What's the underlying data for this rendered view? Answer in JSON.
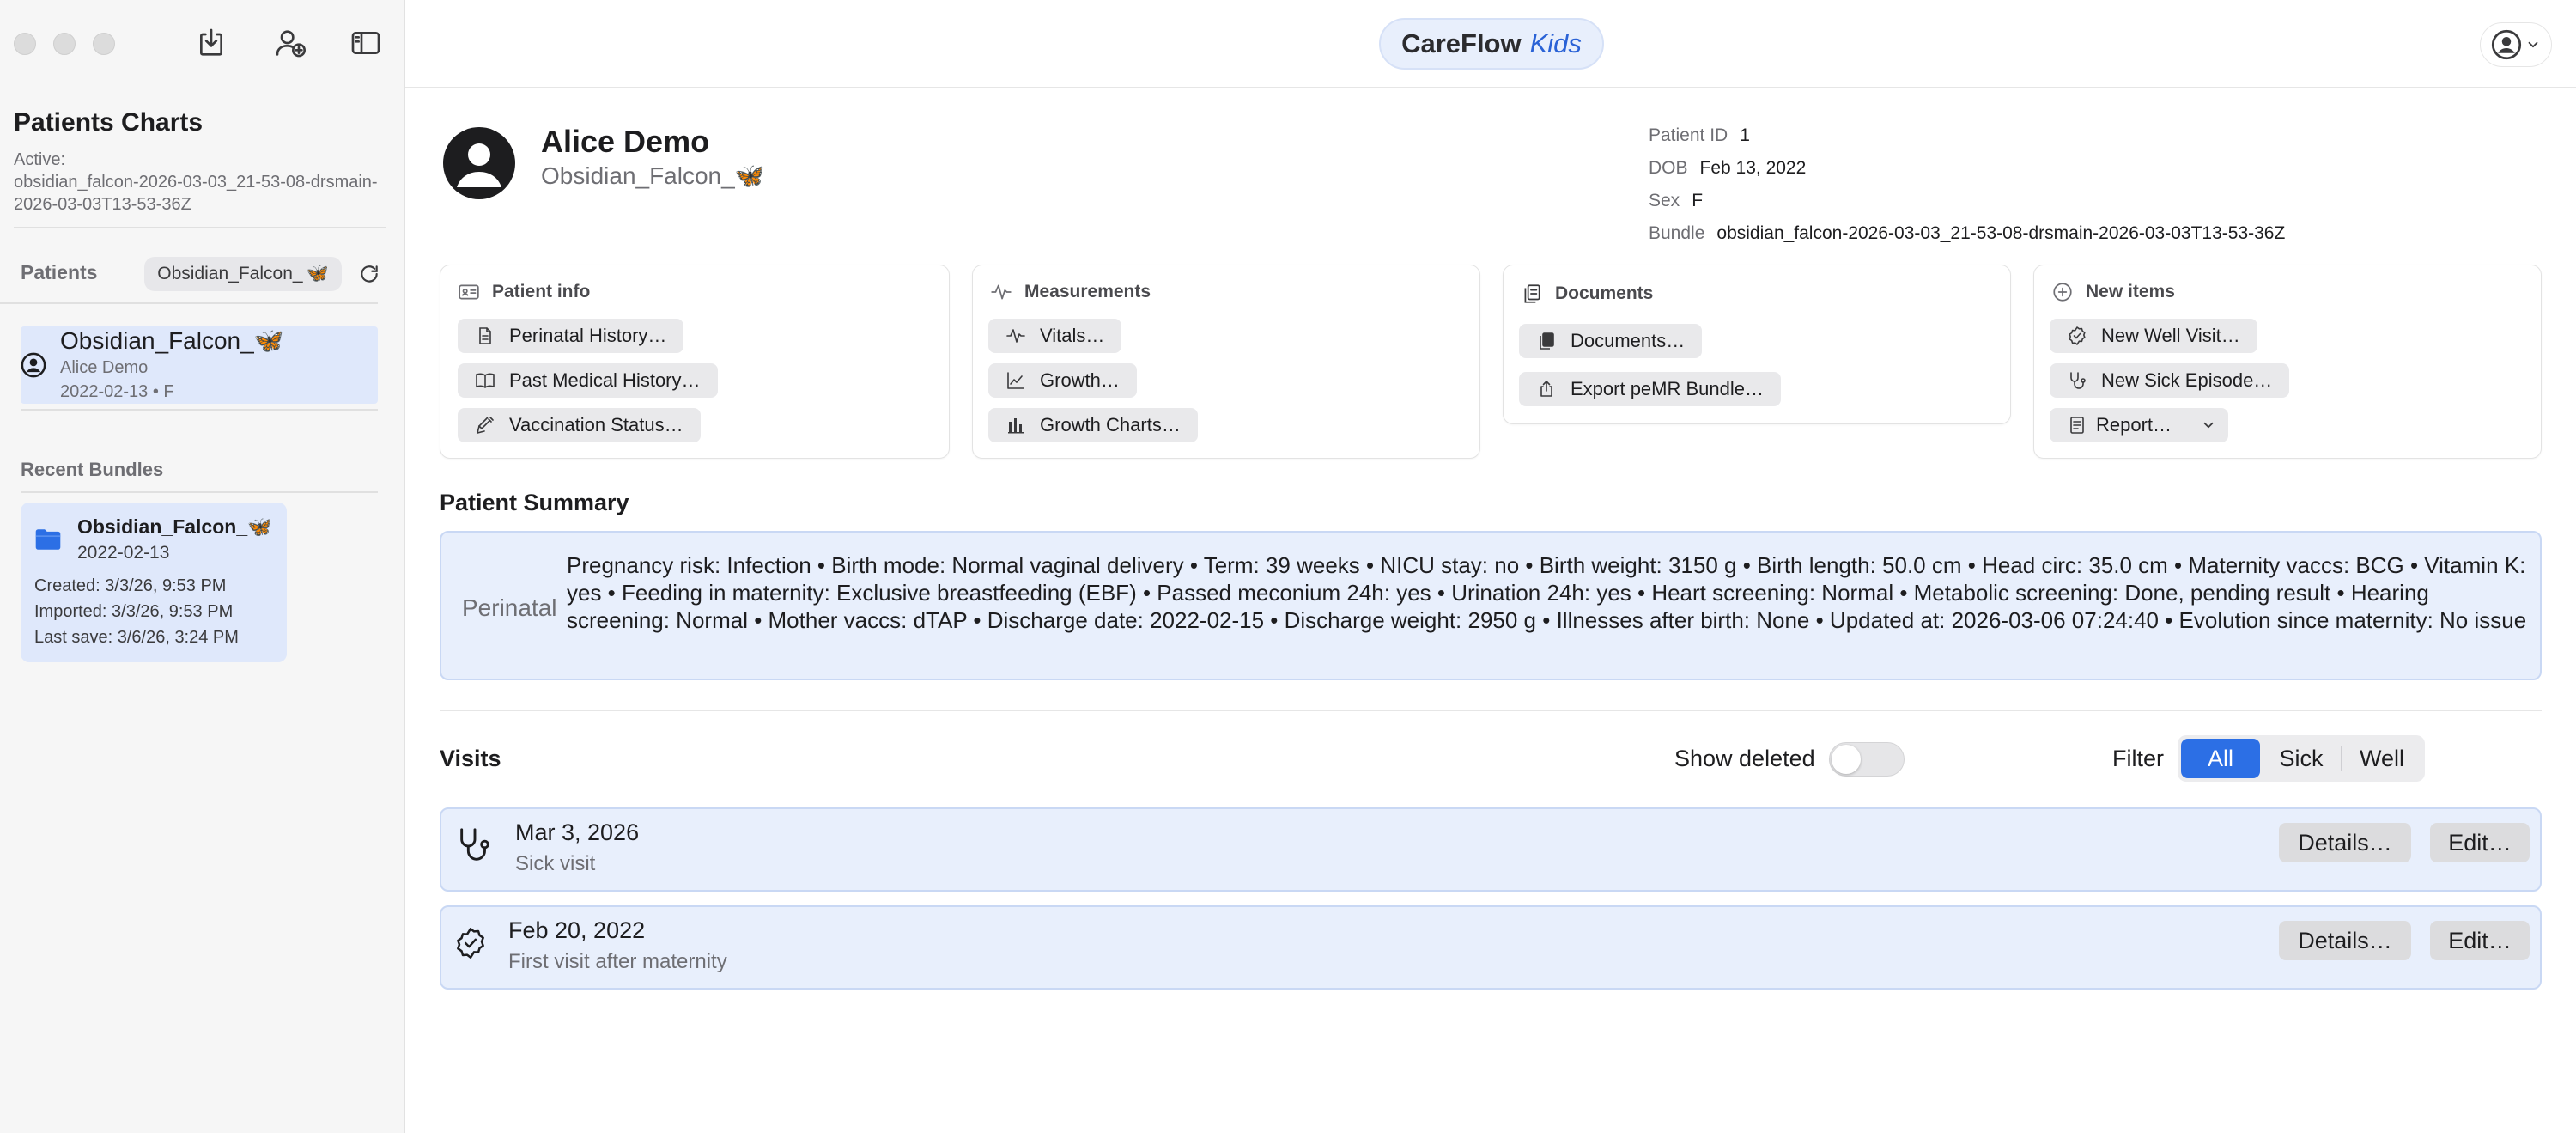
{
  "sidebar": {
    "title": "Patients Charts",
    "active_label": "Active:",
    "active_value": "obsidian_falcon-2026-03-03_21-53-08-drsmain-2026-03-03T13-53-36Z",
    "patients_label": "Patients",
    "patient_chip": "Obsidian_Falcon_",
    "patient": {
      "name": "Obsidian_Falcon_",
      "sub": "Alice Demo",
      "dob_sex": "2022-02-13 • F"
    },
    "recent_label": "Recent Bundles",
    "bundle": {
      "name": "Obsidian_Falcon_",
      "date": "2022-02-13",
      "created": "Created: 3/3/26, 9:53 PM",
      "imported": "Imported: 3/3/26, 9:53 PM",
      "last_save": "Last save: 3/6/26, 3:24 PM"
    }
  },
  "topbar": {
    "brand_main": "CareFlow",
    "brand_accent": "Kids"
  },
  "header": {
    "name": "Alice Demo",
    "alias": "Obsidian_Falcon_",
    "meta": [
      {
        "key": "Patient ID",
        "value": "1"
      },
      {
        "key": "DOB",
        "value": "Feb 13, 2022"
      },
      {
        "key": "Sex",
        "value": "F"
      },
      {
        "key": "Bundle",
        "value": "obsidian_falcon-2026-03-03_21-53-08-drsmain-2026-03-03T13-53-36Z"
      }
    ]
  },
  "cards": {
    "patient_info": {
      "title": "Patient info",
      "buttons": [
        "Perinatal History…",
        "Past Medical History…",
        "Vaccination Status…"
      ]
    },
    "measurements": {
      "title": "Measurements",
      "buttons": [
        "Vitals…",
        "Growth…",
        "Growth Charts…"
      ]
    },
    "documents": {
      "title": "Documents",
      "buttons": [
        "Documents…",
        "Export peMR Bundle…"
      ]
    },
    "new_items": {
      "title": "New items",
      "buttons": [
        "New Well Visit…",
        "New Sick Episode…",
        "Report…"
      ]
    }
  },
  "summary": {
    "title": "Patient Summary",
    "label": "Perinatal",
    "text": "Pregnancy risk: Infection • Birth mode: Normal vaginal delivery • Term: 39 weeks • NICU stay: no • Birth weight: 3150 g • Birth length: 50.0 cm • Head circ: 35.0 cm • Maternity vaccs: BCG • Vitamin K: yes • Feeding in maternity: Exclusive breastfeeding (EBF) • Passed meconium 24h: yes • Urination 24h: yes • Heart screening: Normal • Metabolic screening: Done, pending result • Hearing screening: Normal • Mother vaccs: dTAP • Discharge date: 2022-02-15 • Discharge weight: 2950 g • Illnesses after birth: None • Updated at: 2026-03-06 07:24:40 • Evolution since maternity: No issue"
  },
  "visits": {
    "title": "Visits",
    "show_deleted": "Show deleted",
    "show_deleted_on": false,
    "filter_label": "Filter",
    "filter_options": [
      "All",
      "Sick",
      "Well"
    ],
    "filter_selected": "All",
    "details_label": "Details…",
    "edit_label": "Edit…",
    "items": [
      {
        "date": "Mar 3, 2026",
        "type": "Sick visit",
        "icon": "stethoscope-icon"
      },
      {
        "date": "Feb 20, 2022",
        "type": "First visit after maternity",
        "icon": "checkmark-seal-icon"
      }
    ]
  },
  "colors": {
    "accent": "#2c6fe5",
    "highlight_bg": "#e8effc",
    "selection_bg": "#dfe8fb"
  }
}
